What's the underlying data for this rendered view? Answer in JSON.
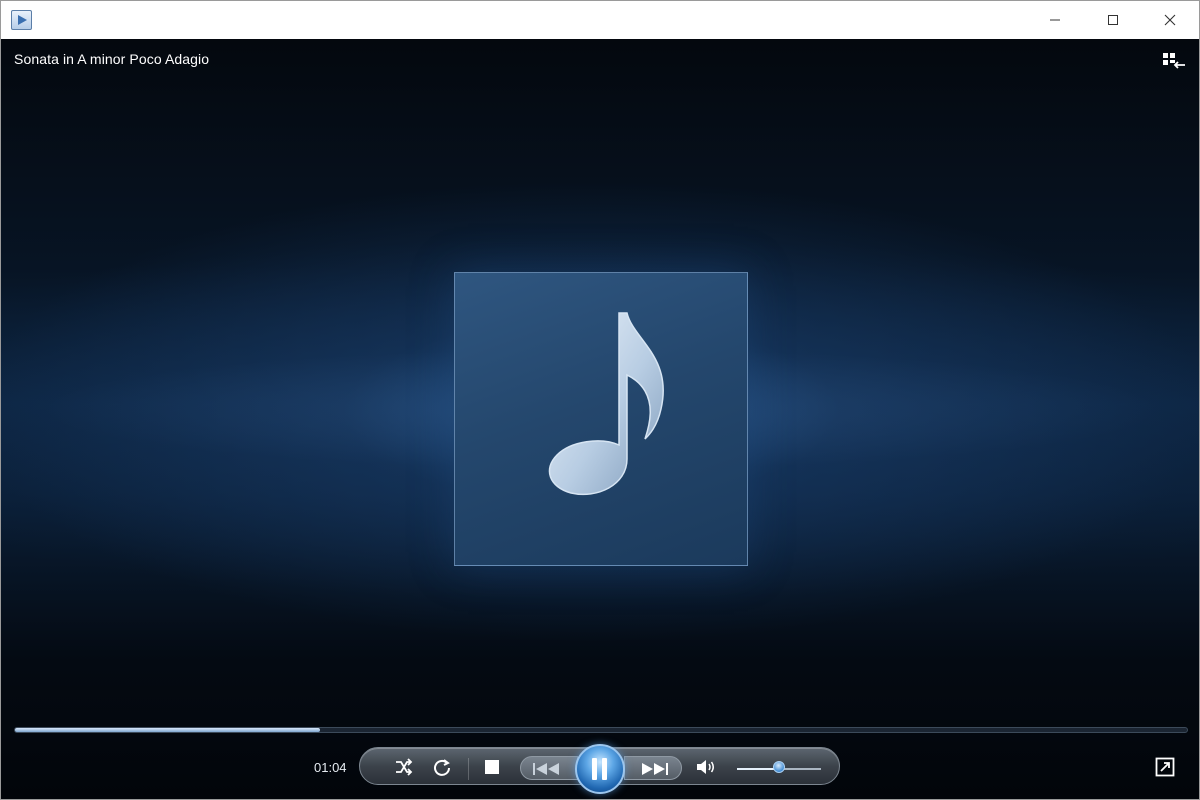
{
  "window": {
    "title_bar_icon": "media-player-icon",
    "controls": [
      "minimize-icon",
      "maximize-icon",
      "close-icon"
    ]
  },
  "player": {
    "now_playing": "Sonata in A minor Poco Adagio",
    "elapsed_time": "01:04",
    "seek_progress": 0.26,
    "volume_level": 0.5,
    "album_art_icon": "music-note-icon",
    "accent_color": "#5ea7e6"
  },
  "controls": {
    "buttons": [
      "shuffle-icon",
      "repeat-icon",
      "stop-icon",
      "previous-icon",
      "pause-icon",
      "next-icon",
      "volume-icon"
    ],
    "switch_view_icon": "switch-to-library-icon",
    "fullscreen_icon": "fullscreen-icon"
  }
}
